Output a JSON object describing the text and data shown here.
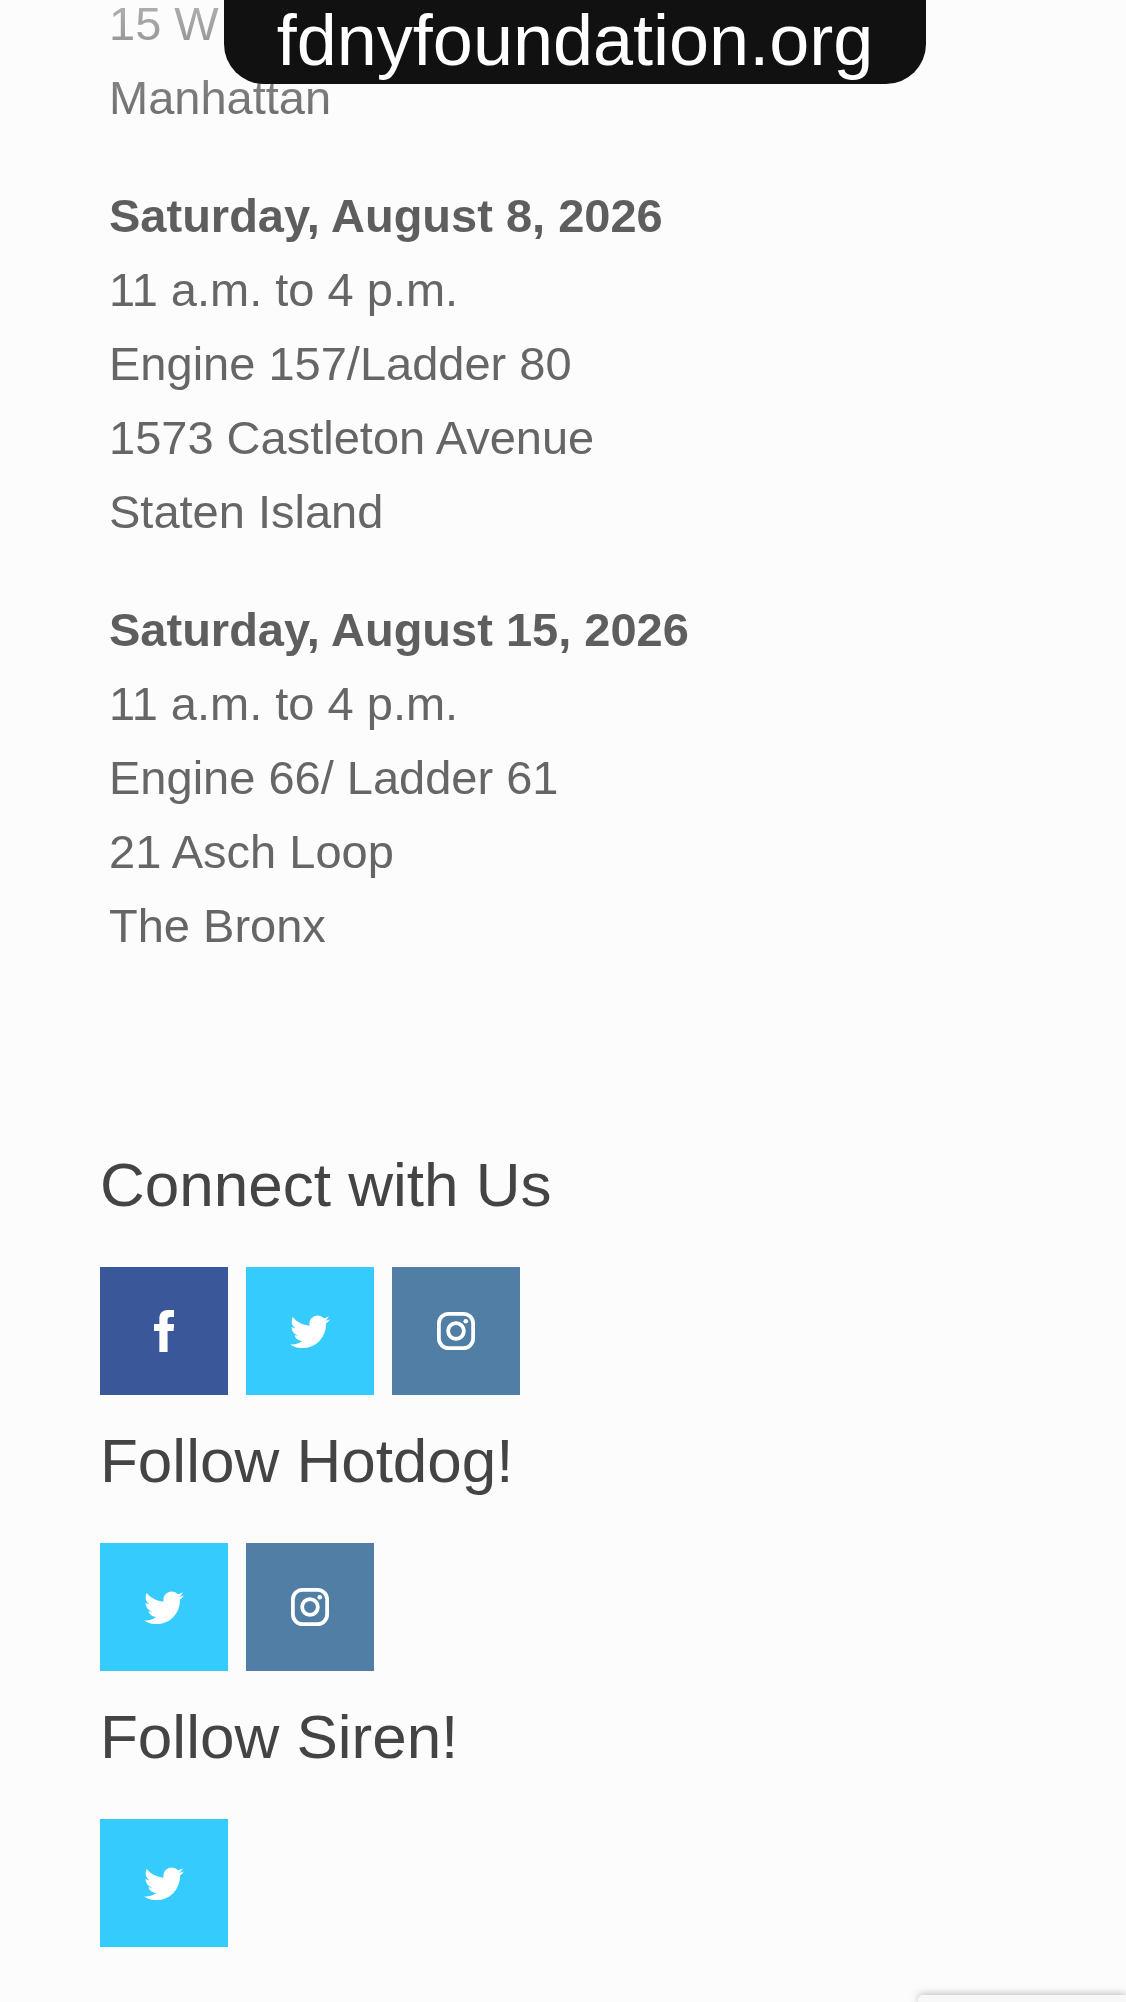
{
  "url_pill": {
    "text": "fdnyfoundation.org"
  },
  "events": [
    {
      "lines": [
        "15 W",
        "Manhattan"
      ]
    },
    {
      "date": "Saturday, August 8, 2026",
      "lines": [
        "11 a.m. to 4 p.m.",
        "Engine 157/Ladder 80",
        "1573 Castleton Avenue",
        "Staten Island"
      ]
    },
    {
      "date": "Saturday, August 15, 2026",
      "lines": [
        "11 a.m. to 4 p.m.",
        "Engine 66/ Ladder 61",
        "21 Asch Loop",
        "The Bronx"
      ]
    }
  ],
  "social_sections": [
    {
      "heading": "Connect with Us",
      "buttons": [
        {
          "kind": "facebook"
        },
        {
          "kind": "twitter"
        },
        {
          "kind": "instagram"
        }
      ]
    },
    {
      "heading": "Follow Hotdog!",
      "buttons": [
        {
          "kind": "twitter"
        },
        {
          "kind": "instagram"
        }
      ]
    },
    {
      "heading": "Follow Siren!",
      "buttons": [
        {
          "kind": "twitter"
        }
      ]
    }
  ]
}
